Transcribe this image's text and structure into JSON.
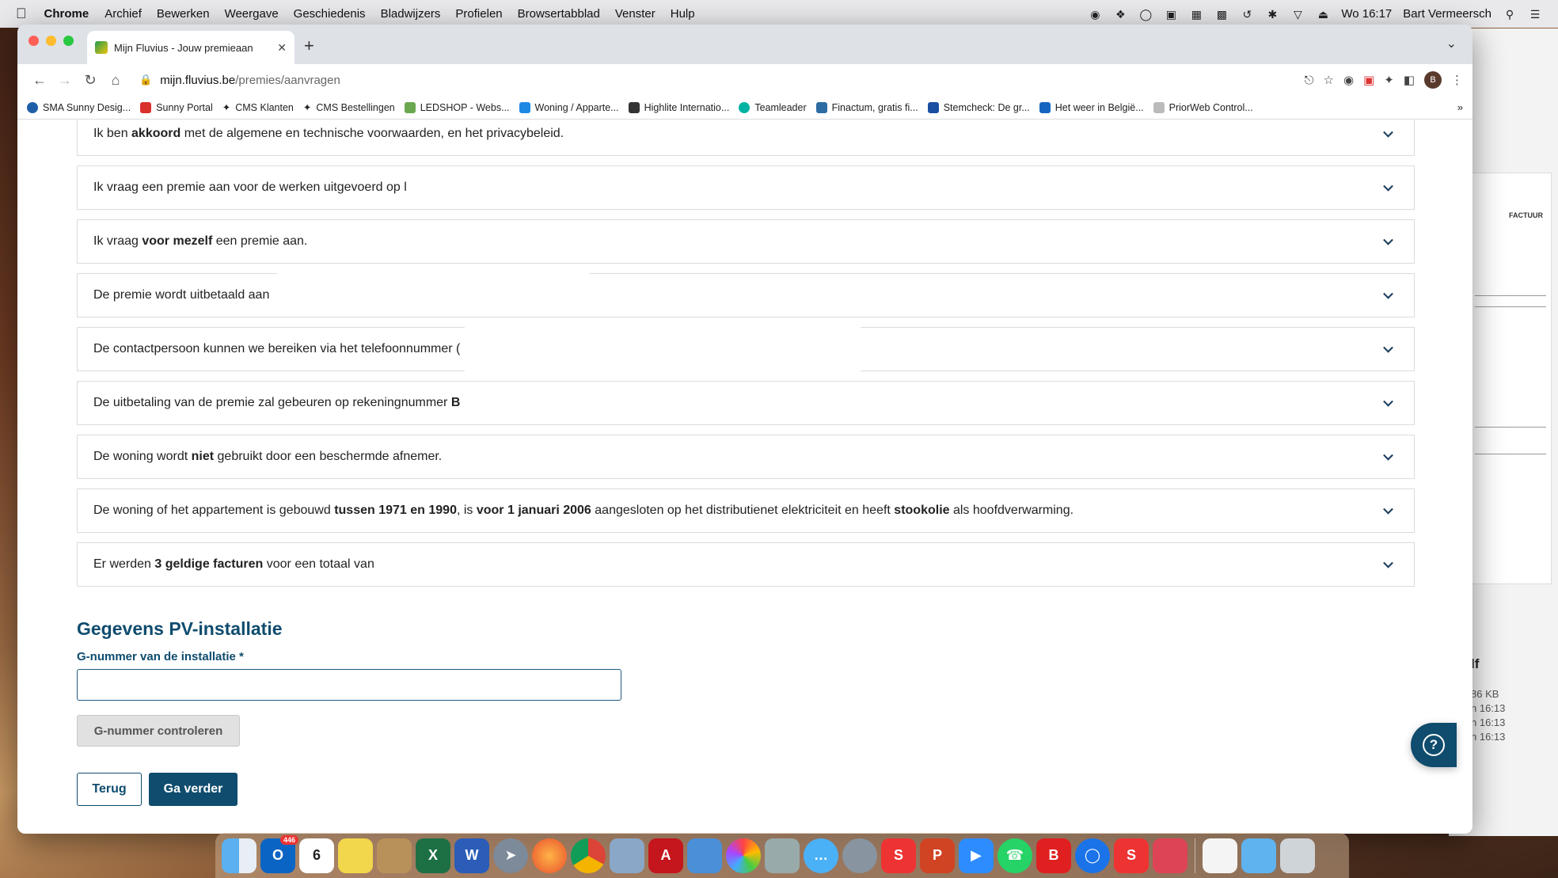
{
  "menubar": {
    "app": "Chrome",
    "items": [
      "Archief",
      "Bewerken",
      "Weergave",
      "Geschiedenis",
      "Bladwijzers",
      "Profielen",
      "Browsertabblad",
      "Venster",
      "Hulp"
    ],
    "clock": "Wo 16:17",
    "user": "Bart Vermeersch"
  },
  "browser": {
    "tab_title": "Mijn Fluvius - Jouw premieaan",
    "url_domain": "mijn.fluvius.be",
    "url_path": "/premies/aanvragen",
    "profile_initial": "B",
    "bookmarks": [
      {
        "label": "SMA Sunny Desig...",
        "color": "#1f5fa8"
      },
      {
        "label": "Sunny Portal",
        "color": "#d9302c"
      },
      {
        "label": "CMS Klanten",
        "color": "#222222"
      },
      {
        "label": "CMS Bestellingen",
        "color": "#222222"
      },
      {
        "label": "LEDSHOP - Webs...",
        "color": "#6aa84f"
      },
      {
        "label": "Woning / Apparte...",
        "color": "#1e88e5"
      },
      {
        "label": "Highlite Internatio...",
        "color": "#333333"
      },
      {
        "label": "Teamleader",
        "color": "#00b3a4"
      },
      {
        "label": "Finactum, gratis fi...",
        "color": "#2d6ca2"
      },
      {
        "label": "Stemcheck: De gr...",
        "color": "#1b4fa0"
      },
      {
        "label": "Het weer in België...",
        "color": "#1565c0"
      },
      {
        "label": "PriorWeb Control...",
        "color": "#bbbbbb"
      }
    ]
  },
  "accordion": [
    {
      "parts": [
        [
          "",
          "Ik ben "
        ],
        [
          "b",
          "akkoord"
        ],
        [
          "",
          " met de algemene en technische voorwaarden, en het privacybeleid."
        ]
      ]
    },
    {
      "parts": [
        [
          "",
          "Ik vraag een premie aan voor de werken uitgevoerd op l"
        ]
      ]
    },
    {
      "parts": [
        [
          "",
          "Ik vraag "
        ],
        [
          "b",
          "voor mezelf"
        ],
        [
          "",
          " een premie aan."
        ]
      ]
    },
    {
      "parts": [
        [
          "",
          "De premie wordt uitbetaald aan"
        ]
      ]
    },
    {
      "parts": [
        [
          "",
          "De contactpersoon kunnen we bereiken via het telefoonnummer ("
        ]
      ]
    },
    {
      "parts": [
        [
          "",
          "De uitbetaling van de premie zal gebeuren op rekeningnummer "
        ],
        [
          "b",
          "B"
        ]
      ]
    },
    {
      "parts": [
        [
          "",
          "De woning wordt "
        ],
        [
          "b",
          "niet"
        ],
        [
          "",
          " gebruikt door een beschermde afnemer."
        ]
      ]
    },
    {
      "parts": [
        [
          "",
          "De woning of het appartement is gebouwd "
        ],
        [
          "b",
          "tussen 1971 en 1990"
        ],
        [
          "",
          ", is "
        ],
        [
          "b",
          "voor 1 januari 2006"
        ],
        [
          "",
          " aangesloten op het distributienet elektriciteit en heeft "
        ],
        [
          "b",
          "stookolie"
        ],
        [
          "",
          " als hoofdverwarming."
        ]
      ]
    },
    {
      "parts": [
        [
          "",
          "Er werden "
        ],
        [
          "b",
          "3 geldige facturen"
        ],
        [
          "",
          " voor een totaal van"
        ]
      ]
    }
  ],
  "pv_section": {
    "title": "Gegevens PV-installatie",
    "field_label": "G-nummer van de installatie *",
    "field_value": "",
    "check_button": "G-nummer controleren"
  },
  "actions": {
    "back": "Terug",
    "next": "Ga verder"
  },
  "help_icon": "question-mark",
  "background_window": {
    "doc_label": "FACTUUR",
    "size_text": "86 KB",
    "times": [
      "n 16:13",
      "n 16:13",
      "n 16:13"
    ],
    "heading_fragment": "lf"
  },
  "dock": {
    "mail_badge": "446",
    "calendar_day": "6"
  }
}
